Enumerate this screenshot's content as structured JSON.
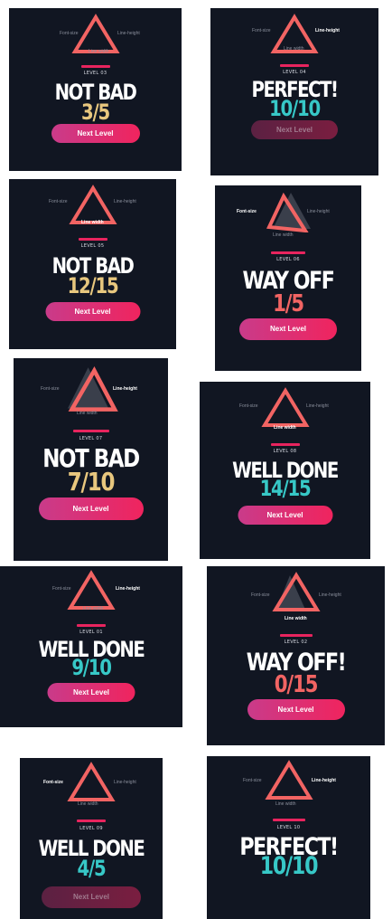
{
  "labels": {
    "font_size": "Font-size",
    "line_height": "Line-height",
    "line_width": "Line width",
    "next": "Next Level"
  },
  "colors": {
    "background": "#111622",
    "triangle": "#f26463",
    "accent": "#e8245e",
    "score_gold": "#e8c77e",
    "score_teal": "#37c8c7",
    "score_red": "#f26463"
  },
  "cards": [
    {
      "level": "LEVEL 03",
      "title": "NOT BAD",
      "score": "3/5",
      "score_color": "#e8c77e",
      "active_label": "none",
      "button_dim": false
    },
    {
      "level": "LEVEL 04",
      "title": "PERFECT!",
      "score": "10/10",
      "score_color": "#37c8c7",
      "active_label": "line-height",
      "button_dim": true
    },
    {
      "level": "LEVEL 05",
      "title": "NOT BAD",
      "score": "12/15",
      "score_color": "#e8c77e",
      "active_label": "line-width",
      "button_dim": false
    },
    {
      "level": "LEVEL 06",
      "title": "WAY OFF",
      "score": "1/5",
      "score_color": "#f26463",
      "active_label": "font-size",
      "button_dim": false
    },
    {
      "level": "LEVEL 07",
      "title": "NOT BAD",
      "score": "7/10",
      "score_color": "#e8c77e",
      "active_label": "line-height",
      "button_dim": false
    },
    {
      "level": "LEVEL 08",
      "title": "WELL DONE",
      "score": "14/15",
      "score_color": "#37c8c7",
      "active_label": "line-width",
      "button_dim": false
    },
    {
      "level": "LEVEL 01",
      "title": "WELL DONE",
      "score": "9/10",
      "score_color": "#37c8c7",
      "active_label": "line-height",
      "button_dim": false
    },
    {
      "level": "LEVEL 02",
      "title": "WAY OFF!",
      "score": "0/15",
      "score_color": "#f26463",
      "active_label": "line-width",
      "button_dim": false
    },
    {
      "level": "LEVEL 09",
      "title": "WELL DONE",
      "score": "4/5",
      "score_color": "#37c8c7",
      "active_label": "font-size",
      "button_dim": true
    },
    {
      "level": "LEVEL 10",
      "title": "PERFECT!",
      "score": "10/10",
      "score_color": "#37c8c7",
      "active_label": "line-height",
      "button_dim": false
    }
  ]
}
